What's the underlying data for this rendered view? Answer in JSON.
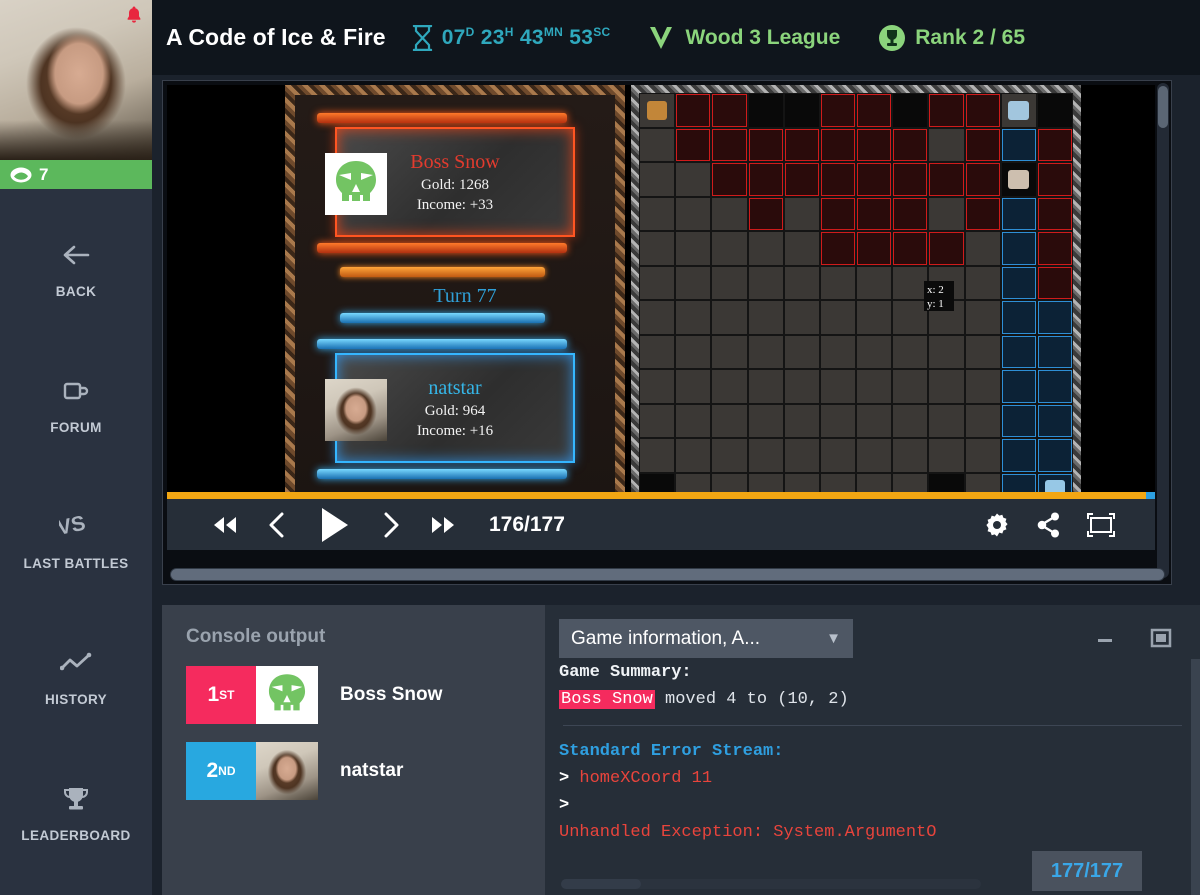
{
  "header": {
    "game_title": "A Code of Ice & Fire",
    "timer": {
      "days": "07",
      "days_unit": "D",
      "hours": "23",
      "hours_unit": "H",
      "minutes": "43",
      "minutes_unit": "MN",
      "seconds": "53",
      "seconds_unit": "SC"
    },
    "league": "Wood 3 League",
    "rank": "Rank 2 / 65",
    "hourglass_icon": "hourglass-icon",
    "league_icon": "wood-league-chevron-icon",
    "rank_icon": "trophy-circle-icon",
    "colors": {
      "timer": "#2fa8bd",
      "league": "#8bd47c",
      "rank": "#8bd47c",
      "background": "#0f151c"
    }
  },
  "sidebar": {
    "webcam": {
      "name": "webcam-feed",
      "bell_icon": "bell-notification-icon"
    },
    "badge": {
      "icon": "cloud-icon",
      "count": "7",
      "color": "#5cb85c"
    },
    "items": [
      {
        "label": "BACK",
        "icon": "arrow-left-icon"
      },
      {
        "label": "FORUM",
        "icon": "mug-icon"
      },
      {
        "label": "LAST BATTLES",
        "icon": "versus-icon"
      },
      {
        "label": "HISTORY",
        "icon": "line-chart-icon"
      },
      {
        "label": "LEADERBOARD",
        "icon": "trophy-icon"
      }
    ]
  },
  "replay": {
    "players": [
      {
        "name": "Boss Snow",
        "gold_label": "Gold: 1268",
        "income_label": "Income: +33",
        "color": "#e23b2e",
        "avatar": "skull-avatar"
      },
      {
        "name": "natstar",
        "gold_label": "Gold: 964",
        "income_label": "Income: +16",
        "color": "#35b6e8",
        "avatar": "face-avatar"
      }
    ],
    "turn_label": "Turn 77",
    "board_tooltip": {
      "x_label": "x: 2",
      "y_label": "y: 1"
    },
    "controls": {
      "rewind_all": "rewind-to-start-icon",
      "step_back": "step-back-icon",
      "play": "play-icon",
      "step_forward": "step-forward-icon",
      "fast_forward": "fast-forward-icon",
      "frame_counter": "176/177",
      "settings": "gear-icon",
      "share": "share-icon",
      "fullscreen": "fullscreen-icon"
    },
    "progress_color": "#f2a613"
  },
  "console": {
    "title": "Console output",
    "rankings": [
      {
        "place": "1",
        "place_suffix": "ST",
        "name": "Boss Snow",
        "color": "#f52b5e",
        "avatar": "skull-avatar"
      },
      {
        "place": "2",
        "place_suffix": "ND",
        "name": "natstar",
        "color": "#28a8e0",
        "avatar": "face-avatar"
      }
    ],
    "select_value": "Game information, A...",
    "select_caret": "chevron-down-icon",
    "minimize_icon": "minimize-icon",
    "maximize_icon": "maximize-icon",
    "summary_heading": "Game Summary:",
    "summary_player": "Boss Snow",
    "summary_text": " moved 4 to (10, 2)",
    "stderr_heading": "Standard Error Stream:",
    "stderr_lines": [
      {
        "prefix": ">",
        "text": " homeXCoord 11",
        "color": "#e8443c"
      },
      {
        "prefix": ">",
        "text": "",
        "color": "#e8443c"
      }
    ],
    "exception_line": "Unhandled Exception: System.ArgumentO",
    "frame_chip": "177/177"
  }
}
